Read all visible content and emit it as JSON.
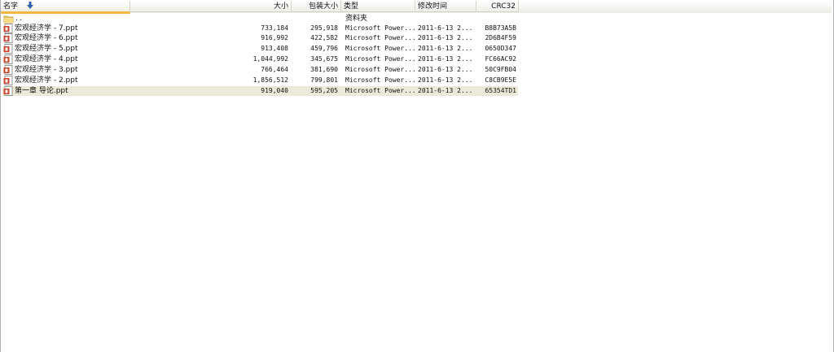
{
  "columns": {
    "name": "名字",
    "size": "大小",
    "packed": "包装大小",
    "type": "类型",
    "modified": "修改时间",
    "crc": "CRC32"
  },
  "parent": {
    "name": "..",
    "type": "资料夹"
  },
  "files": [
    {
      "name": "宏观经济学 - 7.ppt",
      "size": "733,184",
      "packed": "295,918",
      "type": "Microsoft Power...",
      "modified": "2011-6-13 2...",
      "crc": "B8B73A5B"
    },
    {
      "name": "宏观经济学 - 6.ppt",
      "size": "916,992",
      "packed": "422,582",
      "type": "Microsoft Power...",
      "modified": "2011-6-13 2...",
      "crc": "2D6B4F59"
    },
    {
      "name": "宏观经济学 - 5.ppt",
      "size": "913,408",
      "packed": "459,796",
      "type": "Microsoft Power...",
      "modified": "2011-6-13 2...",
      "crc": "0650D347"
    },
    {
      "name": "宏观经济学 - 4.ppt",
      "size": "1,044,992",
      "packed": "345,675",
      "type": "Microsoft Power...",
      "modified": "2011-6-13 2...",
      "crc": "FC66AC92"
    },
    {
      "name": "宏观经济学 - 3.ppt",
      "size": "766,464",
      "packed": "381,690",
      "type": "Microsoft Power...",
      "modified": "2011-6-13 2...",
      "crc": "50C9FB04"
    },
    {
      "name": "宏观经济学 - 2.ppt",
      "size": "1,856,512",
      "packed": "799,801",
      "type": "Microsoft Power...",
      "modified": "2011-6-13 2...",
      "crc": "C8CB9E5E"
    },
    {
      "name": "第一章 导论.ppt",
      "size": "919,040",
      "packed": "595,205",
      "type": "Microsoft Power...",
      "modified": "2011-6-13 2...",
      "crc": "65354TD1"
    }
  ],
  "colors": {
    "sort_indicator": "#f7b73e",
    "selected_row": "#ece9d8",
    "folder": "#f2cf63",
    "ppt_icon": "#c8432a"
  }
}
